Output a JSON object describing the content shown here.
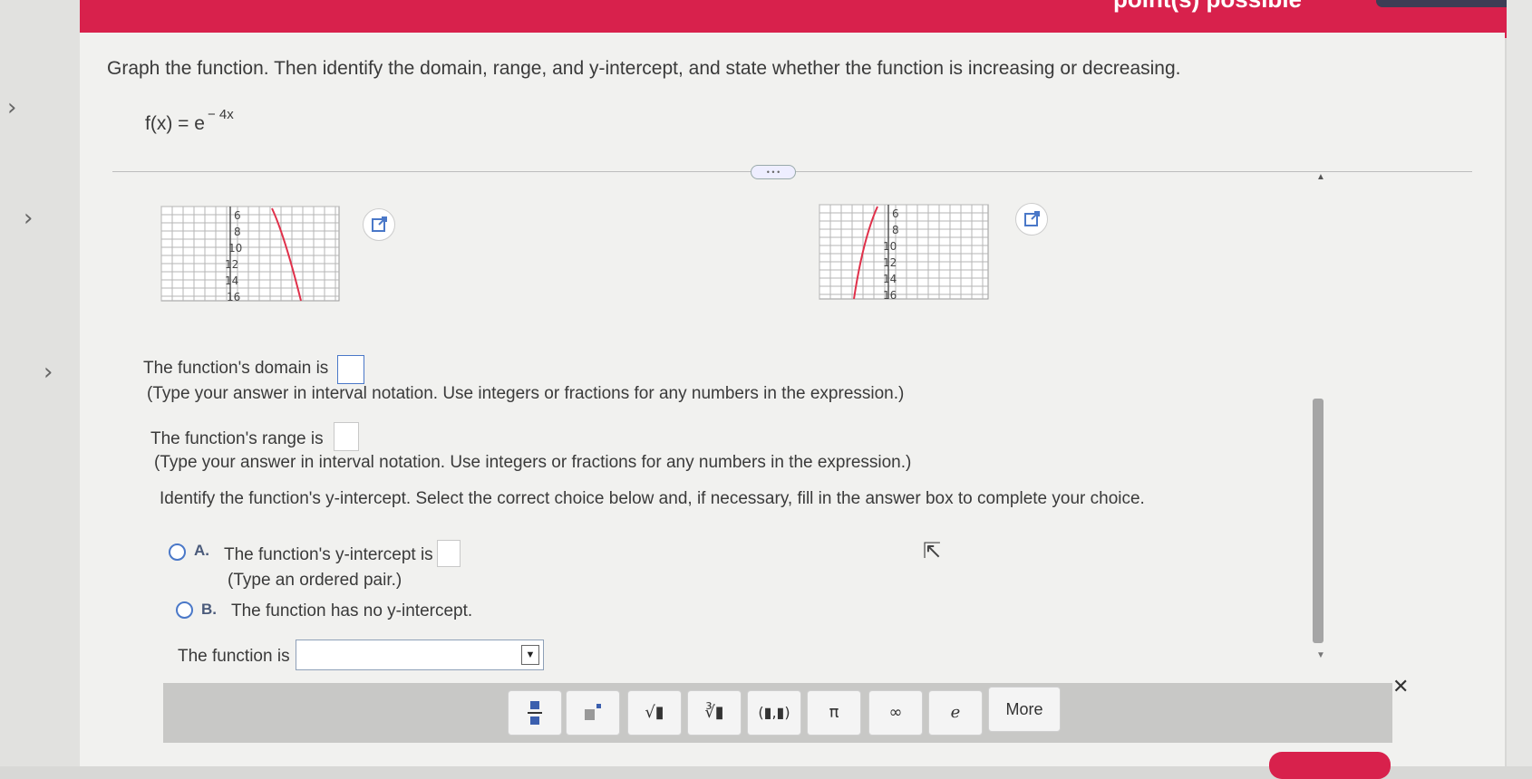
{
  "header": {
    "banner_text": "point(s) possible"
  },
  "question": {
    "prompt": "Graph the function. Then identify the domain, range, and y-intercept, and state whether the function is increasing or decreasing.",
    "function_lhs": "f(x) = e",
    "function_exponent": "− 4x"
  },
  "graphs": [
    {
      "tick_labels": [
        "6",
        "8",
        "10",
        "12",
        "14",
        "16"
      ]
    },
    {
      "tick_labels": [
        "6",
        "8",
        "10",
        "12",
        "14",
        "16"
      ]
    }
  ],
  "domain": {
    "label": "The function's domain is",
    "hint": "(Type your answer in interval notation. Use integers or fractions for any numbers in the expression.)"
  },
  "range": {
    "label": "The function's range is",
    "hint": "(Type your answer in interval notation. Use integers or fractions for any numbers in the expression.)"
  },
  "intercept": {
    "instruction": "Identify the function's y-intercept. Select the correct choice below and, if necessary, fill in the answer box to complete your choice.",
    "choice_a_letter": "A.",
    "choice_a_text": "The function's y-intercept is",
    "choice_a_hint": "(Type an ordered pair.)",
    "choice_b_letter": "B.",
    "choice_b_text": "The function has no y-intercept."
  },
  "monotonic": {
    "label": "The function is"
  },
  "toolbar": {
    "buttons": [
      "fraction",
      "exponent",
      "√▮",
      "∛▮",
      "(▮,▮)",
      "π",
      "∞",
      "e"
    ],
    "more_label": "More"
  }
}
